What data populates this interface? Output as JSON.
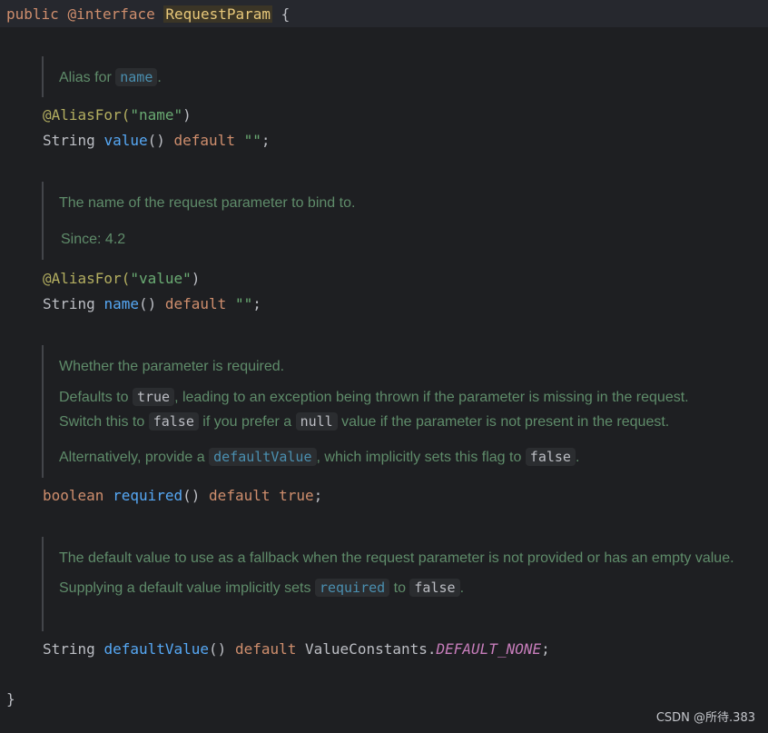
{
  "header": {
    "public": "public",
    "interface": "@interface",
    "name": "RequestParam",
    "brace": "{"
  },
  "doc1": {
    "text": "Alias for ",
    "chip": "name",
    "tail": "."
  },
  "value_decl": {
    "annotation": "@AliasFor(",
    "annotation_arg": "\"name\"",
    "annotation_close": ")",
    "type": "String",
    "method": "value",
    "parens": "()",
    "default": "default",
    "val": "\"\"",
    "semi": ";"
  },
  "doc2": {
    "text": "The name of the request parameter to bind to.",
    "since": "Since: 4.2"
  },
  "name_decl": {
    "annotation": "@AliasFor(",
    "annotation_arg": "\"value\"",
    "annotation_close": ")",
    "type": "String",
    "method": "name",
    "parens": "()",
    "default": "default",
    "val": "\"\"",
    "semi": ";"
  },
  "doc3": {
    "line1": "Whether the parameter is required.",
    "line2a": "Defaults to ",
    "chip_true": "true",
    "line2b": ", leading to an exception being thrown if the parameter is missing in the request.",
    "line3a": "Switch this to ",
    "chip_false": "false",
    "line3b": " if you prefer a ",
    "chip_null": "null",
    "line3c": " value if the parameter is not present in the request.",
    "line4a": "Alternatively, provide a ",
    "chip_default": "defaultValue",
    "line4b": ", which implicitly sets this flag to ",
    "chip_false2": "false",
    "line4c": "."
  },
  "required_decl": {
    "type": "boolean",
    "method": "required",
    "parens": "()",
    "default": "default",
    "val": "true",
    "semi": ";"
  },
  "doc4": {
    "line1": "The default value to use as a fallback when the request parameter is not provided or has an empty value.",
    "line2a": "Supplying a default value implicitly sets ",
    "chip_required": "required",
    "line2b": " to ",
    "chip_false": "false",
    "line2c": "."
  },
  "default_decl": {
    "type": "String",
    "method": "defaultValue",
    "parens": "()",
    "default": "default",
    "cls": "ValueConstants.",
    "const": "DEFAULT_NONE",
    "semi": ";"
  },
  "footer": {
    "brace": "}"
  },
  "watermark": "CSDN @所待.383"
}
